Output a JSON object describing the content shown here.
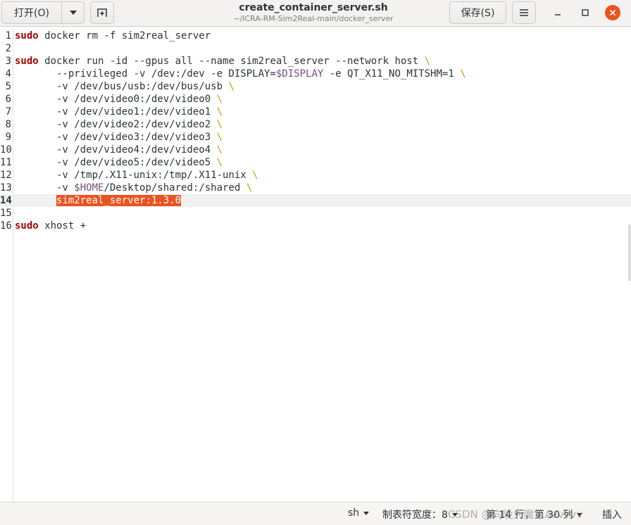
{
  "header": {
    "open_label": "打开(O)",
    "save_label": "保存(S)",
    "title": "create_container_server.sh",
    "subtitle": "~/ICRA-RM-Sim2Real-main/docker_server"
  },
  "editor": {
    "current_line": 14,
    "selected_text": "sim2real_server:1.3.0",
    "lines": [
      {
        "n": "1",
        "text": "sudo docker rm -f sim2real_server"
      },
      {
        "n": "2",
        "text": ""
      },
      {
        "n": "3",
        "text": "sudo docker run -id --gpus all --name sim2real_server --network host \\"
      },
      {
        "n": "4",
        "text": "       --privileged -v /dev:/dev -e DISPLAY=$DISPLAY -e QT_X11_NO_MITSHM=1 \\"
      },
      {
        "n": "5",
        "text": "       -v /dev/bus/usb:/dev/bus/usb \\"
      },
      {
        "n": "6",
        "text": "       -v /dev/video0:/dev/video0 \\"
      },
      {
        "n": "7",
        "text": "       -v /dev/video1:/dev/video1 \\"
      },
      {
        "n": "8",
        "text": "       -v /dev/video2:/dev/video2 \\"
      },
      {
        "n": "9",
        "text": "       -v /dev/video3:/dev/video3 \\"
      },
      {
        "n": "10",
        "text": "       -v /dev/video4:/dev/video4 \\"
      },
      {
        "n": "11",
        "text": "       -v /dev/video5:/dev/video5 \\"
      },
      {
        "n": "12",
        "text": "       -v /tmp/.X11-unix:/tmp/.X11-unix \\"
      },
      {
        "n": "13",
        "text": "       -v $HOME/Desktop/shared:/shared \\"
      },
      {
        "n": "14",
        "text": "       sim2real_server:1.3.0"
      },
      {
        "n": "15",
        "text": ""
      },
      {
        "n": "16",
        "text": "sudo xhost +"
      }
    ]
  },
  "statusbar": {
    "language": "sh",
    "tab_width": "制表符宽度：8",
    "position": "第 14 行，第 30 列",
    "mode": "插入",
    "watermark": "CSDN @向晚大魔王Avvvvv"
  },
  "colors": {
    "accent": "#e95420",
    "keyword": "#a40000",
    "variable": "#75507b",
    "continuation": "#c4a000"
  }
}
